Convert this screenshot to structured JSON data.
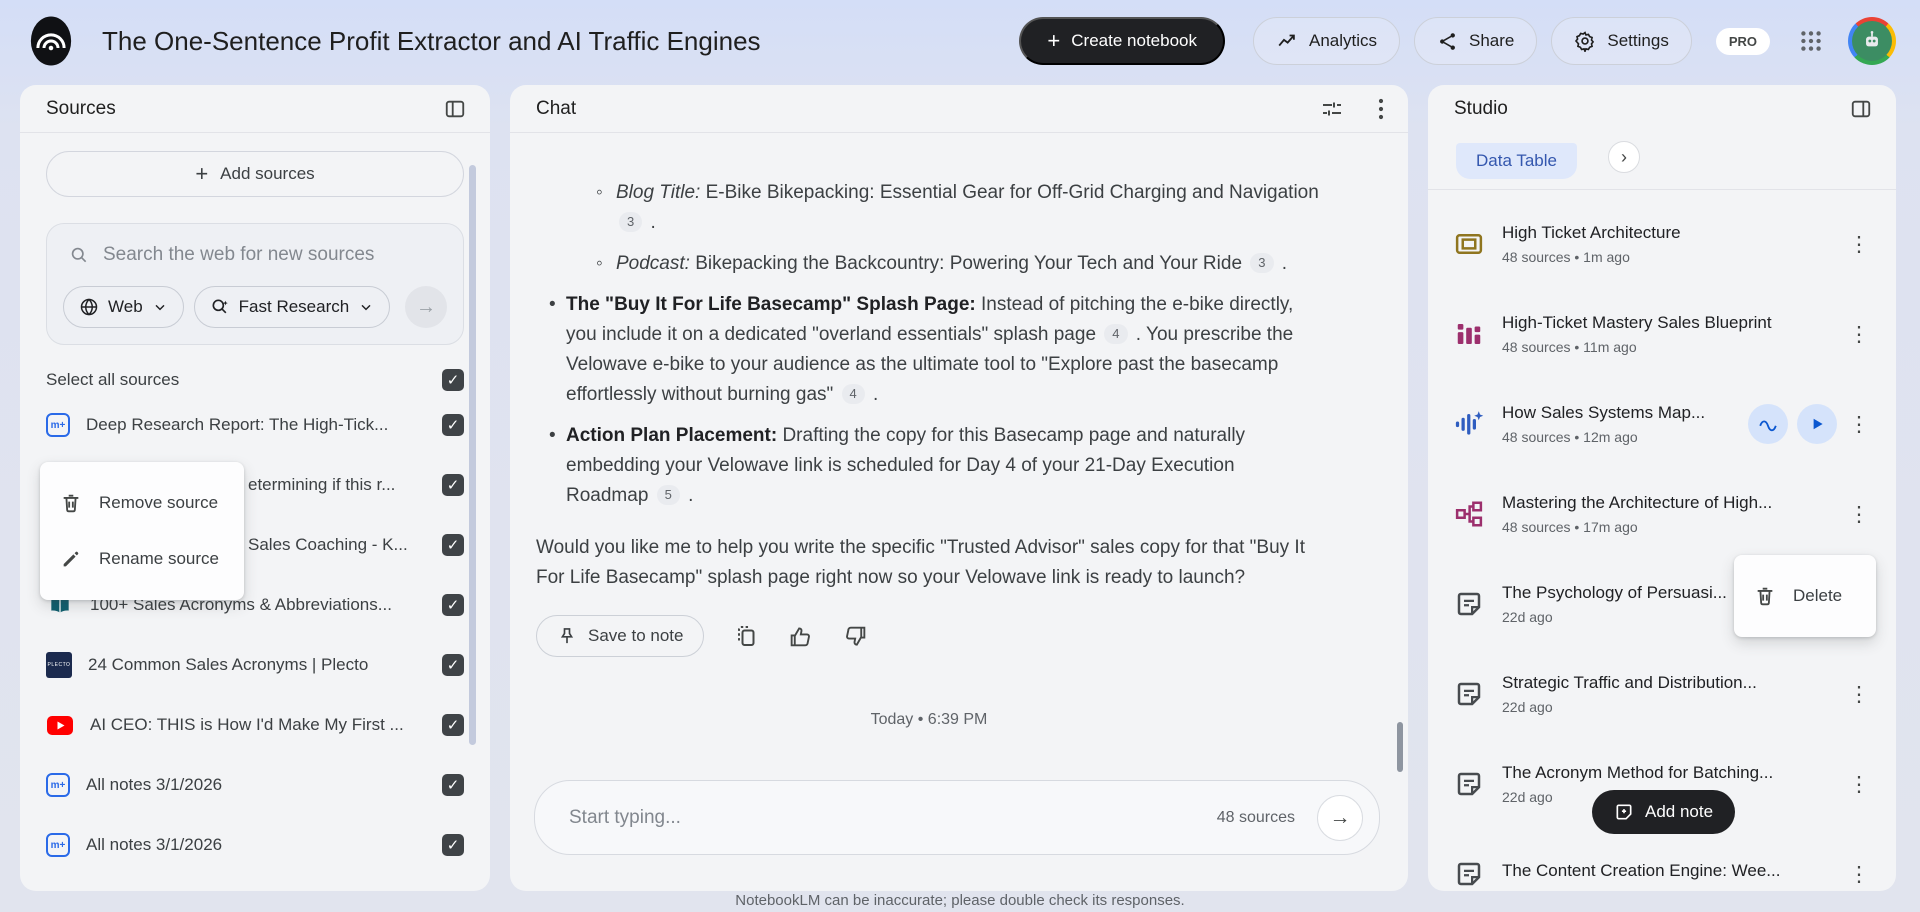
{
  "header": {
    "title": "The One-Sentence Profit Extractor and AI Traffic Engines",
    "create_notebook": "Create notebook",
    "analytics": "Analytics",
    "share": "Share",
    "settings": "Settings",
    "pro": "PRO"
  },
  "sources": {
    "title": "Sources",
    "add": "Add sources",
    "search_placeholder": "Search the web for new sources",
    "web": "Web",
    "research_mode": "Fast Research",
    "select_all": "Select all sources",
    "items": [
      {
        "icon": "notebooklm-note",
        "title": "Deep Research Report: The High-Tick...",
        "checked": true
      },
      {
        "icon": "none",
        "title": "etermining if this r...",
        "checked": true
      },
      {
        "icon": "none",
        "title": "Sales Coaching - K...",
        "checked": true
      },
      {
        "icon": "book",
        "title": "100+ Sales Acronyms & Abbreviations...",
        "checked": true
      },
      {
        "icon": "plecto",
        "title": "24 Common Sales Acronyms | Plecto",
        "checked": true
      },
      {
        "icon": "youtube",
        "title": "AI CEO: THIS is How I'd Make My First ...",
        "checked": true
      },
      {
        "icon": "notebooklm-note",
        "title": "All notes 3/1/2026",
        "checked": true
      },
      {
        "icon": "notebooklm-note",
        "title": "All notes 3/1/2026",
        "checked": true
      }
    ],
    "menu": {
      "remove": "Remove source",
      "rename": "Rename source"
    }
  },
  "chat": {
    "title": "Chat",
    "blocks": [
      {
        "type": "sub",
        "segments": [
          {
            "style": "i",
            "t": "Blog Title:"
          },
          {
            "t": " E-Bike Bikepacking: Essential Gear for Off-Grid Charging and Navigation "
          },
          {
            "style": "cite",
            "t": "3"
          },
          {
            "t": " ."
          }
        ]
      },
      {
        "type": "sub",
        "segments": [
          {
            "style": "i",
            "t": "Podcast:"
          },
          {
            "t": " Bikepacking the Backcountry: Powering Your Tech and Your Ride "
          },
          {
            "style": "cite",
            "t": "3"
          },
          {
            "t": " ."
          }
        ]
      },
      {
        "type": "bullet",
        "segments": [
          {
            "style": "b",
            "t": "The \"Buy It For Life Basecamp\" Splash Page:"
          },
          {
            "t": " Instead of pitching the e-bike directly, you include it on a dedicated \"overland essentials\" splash page "
          },
          {
            "style": "cite",
            "t": "4"
          },
          {
            "t": " . You prescribe the Velowave e-bike to your audience as the ultimate tool to \"Explore past the basecamp effortlessly without burning gas\" "
          },
          {
            "style": "cite",
            "t": "4"
          },
          {
            "t": " ."
          }
        ]
      },
      {
        "type": "bullet",
        "segments": [
          {
            "style": "b",
            "t": "Action Plan Placement:"
          },
          {
            "t": " Drafting the copy for this Basecamp page and naturally embedding your Velowave link is scheduled for Day 4 of your 21-Day Execution Roadmap "
          },
          {
            "style": "cite",
            "t": "5"
          },
          {
            "t": " ."
          }
        ]
      },
      {
        "type": "para",
        "segments": [
          {
            "t": "Would you like me to help you write the specific \"Trusted Advisor\" sales copy for that \"Buy It For Life Basecamp\" splash page right now so your Velowave link is ready to launch?"
          }
        ]
      }
    ],
    "save_to_note": "Save to note",
    "timestamp": "Today • 6:39 PM",
    "input_placeholder": "Start typing...",
    "sources_count": "48 sources",
    "disclaimer": "NotebookLM can be inaccurate; please double check its responses."
  },
  "studio": {
    "title": "Studio",
    "chip": "Data Table",
    "items": [
      {
        "icon": "flashcards",
        "color": "#8f751f",
        "title": "High Ticket Architecture",
        "meta": "48 sources • 1m ago",
        "actions": false
      },
      {
        "icon": "report",
        "color": "#9c2f6d",
        "title": "High-Ticket Mastery Sales Blueprint",
        "meta": "48 sources • 11m ago",
        "actions": false
      },
      {
        "icon": "audio",
        "color": "#2f5dc0",
        "title": "How Sales Systems Map...",
        "meta": "48 sources • 12m ago",
        "actions": true
      },
      {
        "icon": "mindmap",
        "color": "#9c2f6d",
        "title": "Mastering the Architecture of High...",
        "meta": "48 sources • 17m ago",
        "actions": false
      },
      {
        "icon": "note",
        "color": "#474b4f",
        "title": "The Psychology of Persuasi...",
        "meta": "22d ago",
        "actions": false
      },
      {
        "icon": "note",
        "color": "#474b4f",
        "title": "Strategic Traffic and Distribution...",
        "meta": "22d ago",
        "actions": false
      },
      {
        "icon": "note",
        "color": "#474b4f",
        "title": "The Acronym Method for Batching...",
        "meta": "22d ago",
        "actions": false
      },
      {
        "icon": "note",
        "color": "#474b4f",
        "title": "The Content Creation Engine: Wee...",
        "meta": "",
        "actions": false
      }
    ],
    "menu": {
      "delete": "Delete"
    },
    "add_note": "Add note"
  },
  "colors": {
    "accent_blue": "#0b57d0",
    "chip_bg": "#dfe8fb",
    "chip_text": "#3457ae",
    "youtube_red": "#ff0000",
    "plecto_navy": "#1b2a4e",
    "dark_button": "#202124"
  }
}
